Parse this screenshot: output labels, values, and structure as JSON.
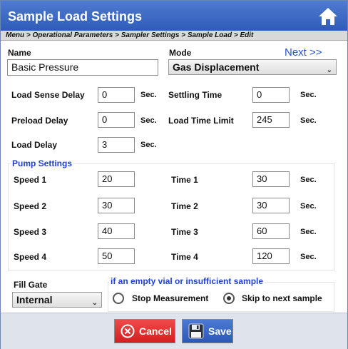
{
  "window": {
    "title": "Sample Load Settings"
  },
  "breadcrumb": "Menu > Operational Parameters > Sampler Settings > Sample Load > Edit",
  "name": {
    "label": "Name",
    "value": "Basic Pressure"
  },
  "mode": {
    "label": "Mode",
    "value": "Gas Displacement"
  },
  "next_label": "Next >>",
  "fields": {
    "load_sense_delay": {
      "label": "Load Sense Delay",
      "value": "0",
      "unit": "Sec."
    },
    "preload_delay": {
      "label": "Preload Delay",
      "value": "0",
      "unit": "Sec."
    },
    "load_delay": {
      "label": "Load Delay",
      "value": "3",
      "unit": "Sec."
    },
    "settling_time": {
      "label": "Settling Time",
      "value": "0",
      "unit": "Sec."
    },
    "load_time_limit": {
      "label": "Load Time Limit",
      "value": "245",
      "unit": "Sec."
    }
  },
  "pump": {
    "title": "Pump Settings",
    "speeds": [
      {
        "label": "Speed 1",
        "value": "20"
      },
      {
        "label": "Speed 2",
        "value": "30"
      },
      {
        "label": "Speed 3",
        "value": "40"
      },
      {
        "label": "Speed 4",
        "value": "50"
      }
    ],
    "times": [
      {
        "label": "Time 1",
        "value": "30",
        "unit": "Sec."
      },
      {
        "label": "Time 2",
        "value": "30",
        "unit": "Sec."
      },
      {
        "label": "Time 3",
        "value": "60",
        "unit": "Sec."
      },
      {
        "label": "Time 4",
        "value": "120",
        "unit": "Sec."
      }
    ]
  },
  "fill_gate": {
    "label": "Fill Gate",
    "value": "Internal"
  },
  "empty_vial": {
    "title": "if an empty vial or insufficient sample",
    "options": [
      {
        "label": "Stop Measurement",
        "selected": false
      },
      {
        "label": "Skip to next sample",
        "selected": true
      }
    ]
  },
  "buttons": {
    "cancel": "Cancel",
    "save": "Save"
  },
  "colors": {
    "title_bar": "#3a67c4",
    "accent_blue": "#2553c9",
    "cancel_red": "#e13030",
    "save_blue": "#3a67c4"
  }
}
